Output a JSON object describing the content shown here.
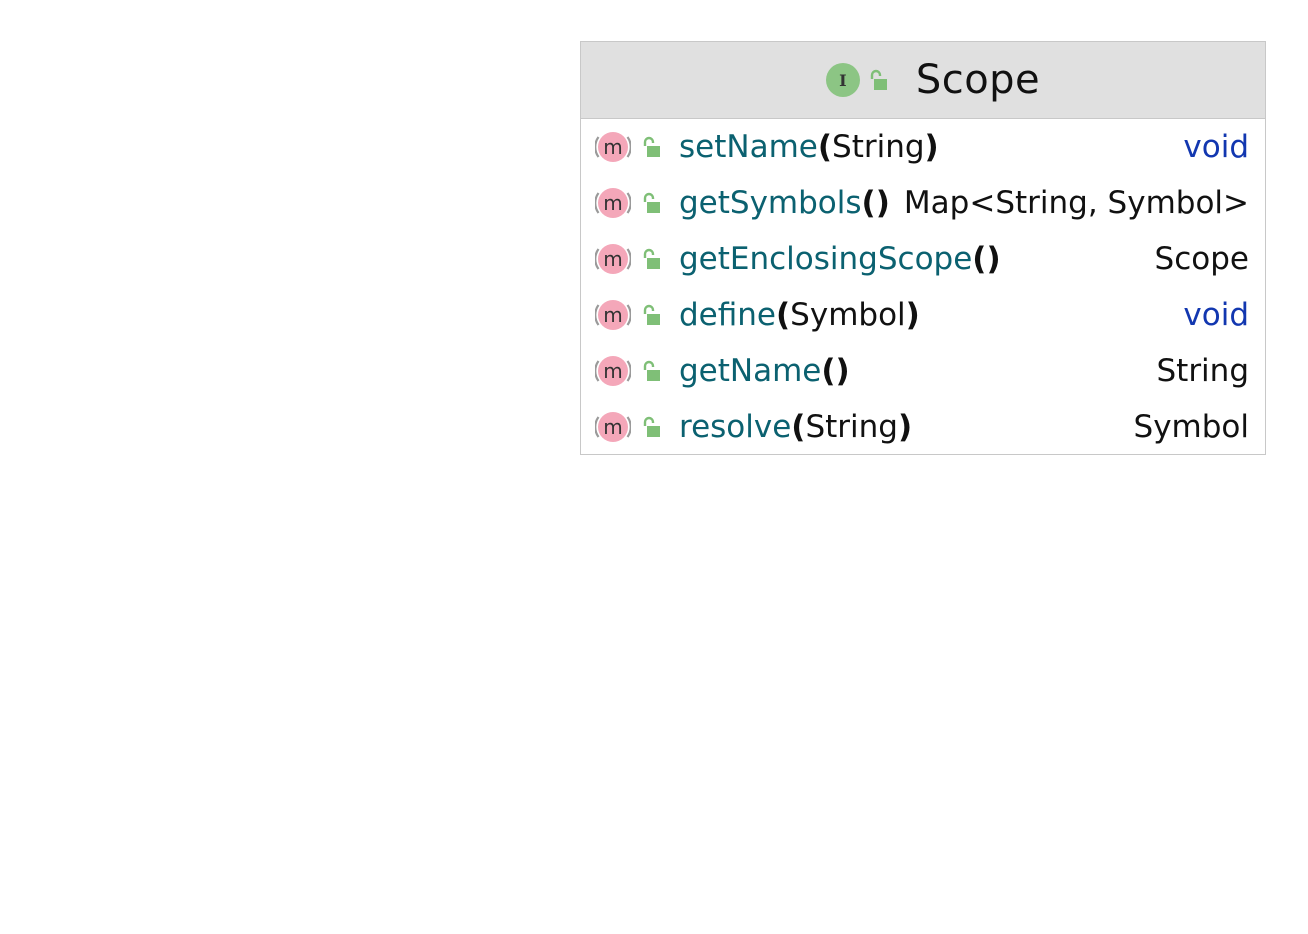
{
  "class": {
    "name": "Scope",
    "kind_icon": "interface-icon",
    "kind_letter": "I",
    "visibility_icon": "unlocked-icon"
  },
  "colors": {
    "header_bg": "#e0e0e0",
    "border": "#c8c8c8",
    "method_name": "#0b6170",
    "keyword_type": "#1237b0",
    "interface_icon": "#8cc584",
    "method_icon": "#f4a7b9"
  },
  "methods": [
    {
      "name": "setName",
      "params": "String",
      "return_type": "void",
      "return_is_keyword": true
    },
    {
      "name": "getSymbols",
      "params": "",
      "return_type": "Map<String, Symbol>",
      "return_is_keyword": false
    },
    {
      "name": "getEnclosingScope",
      "params": "",
      "return_type": "Scope",
      "return_is_keyword": false
    },
    {
      "name": "define",
      "params": "Symbol",
      "return_type": "void",
      "return_is_keyword": true
    },
    {
      "name": "getName",
      "params": "",
      "return_type": "String",
      "return_is_keyword": false
    },
    {
      "name": "resolve",
      "params": "String",
      "return_type": "Symbol",
      "return_is_keyword": false
    }
  ],
  "method_icon_letter": "m"
}
